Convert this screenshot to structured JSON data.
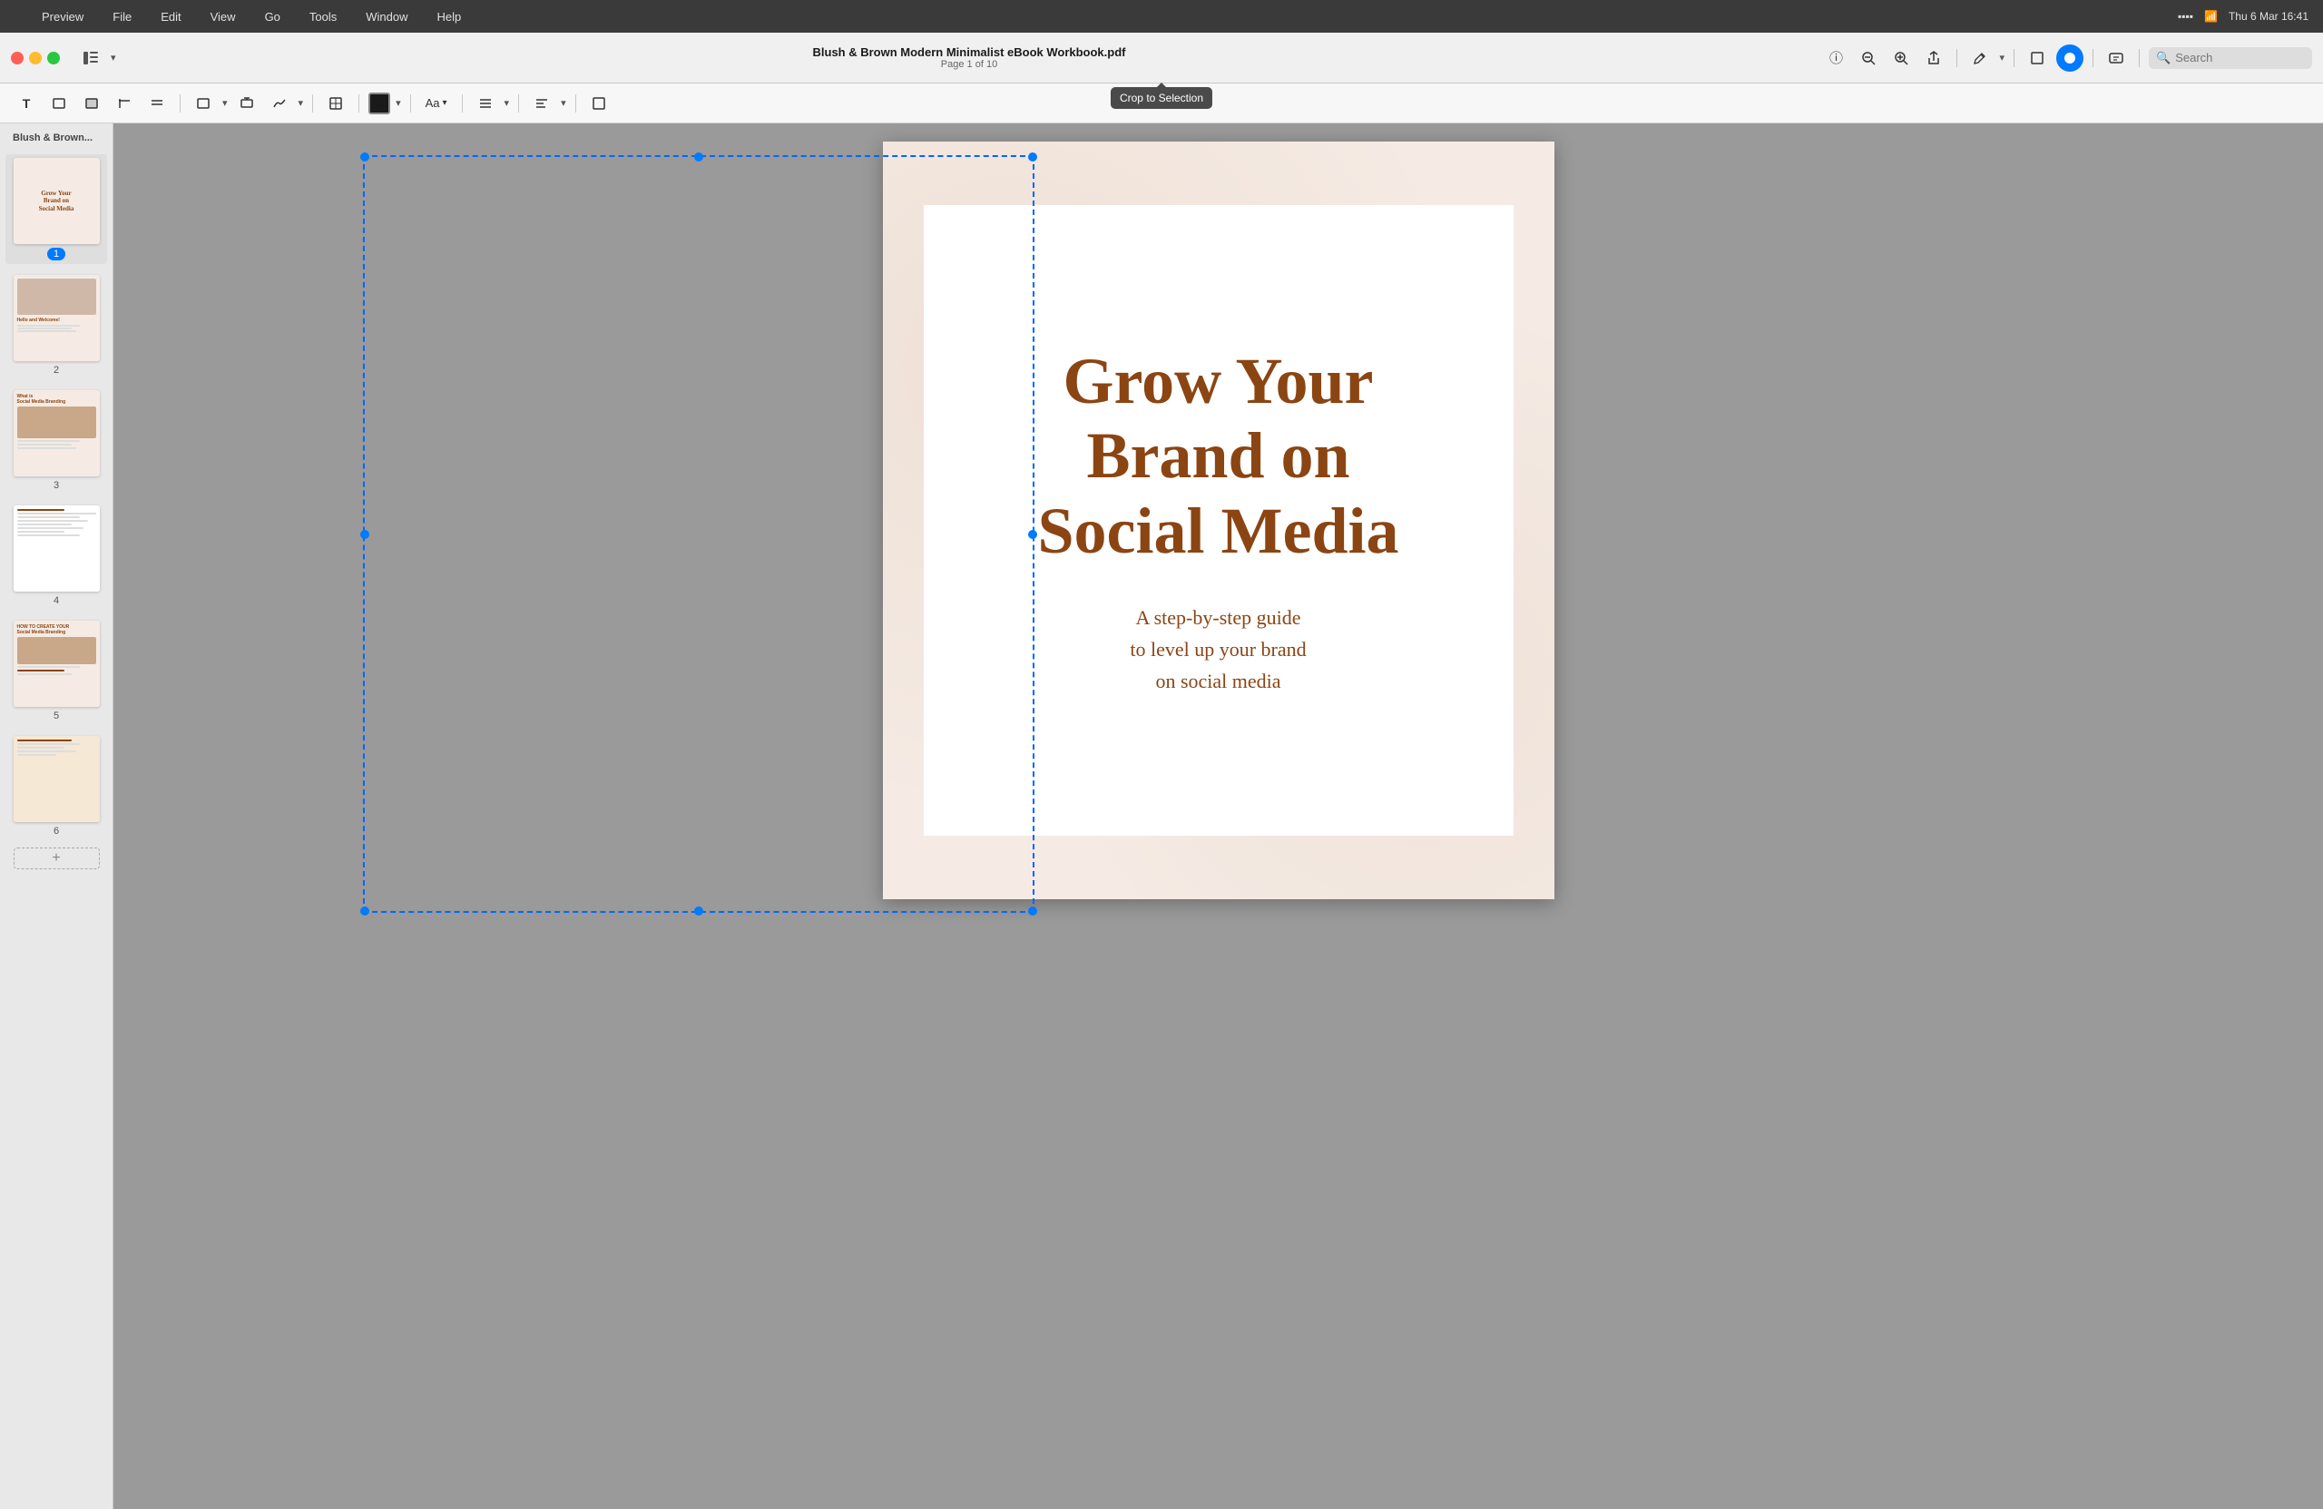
{
  "menubar": {
    "apple_symbol": "",
    "items": [
      "Preview",
      "File",
      "Edit",
      "View",
      "Go",
      "Tools",
      "Window",
      "Help"
    ],
    "right": {
      "datetime": "Thu 6 Mar  16:41"
    }
  },
  "toolbar": {
    "doc_title": "Blush & Brown Modern Minimalist eBook Workbook.pdf",
    "doc_page": "Page 1 of 10",
    "sidebar_label": "Blush & Brown..."
  },
  "annotation_bar": {
    "crop_tooltip": "Crop to Selection",
    "color_label": "Aa",
    "font_label": "Aa"
  },
  "search": {
    "placeholder": "Search",
    "value": ""
  },
  "document": {
    "main_title": "Grow Your Brand on Social Media",
    "subtitle_line1": "A step-by-step guide",
    "subtitle_line2": "to level up your brand",
    "subtitle_line3": "on social media"
  },
  "sidebar": {
    "label": "Blush & Brown...",
    "pages": [
      {
        "num": "1",
        "active": true
      },
      {
        "num": "2",
        "active": false
      },
      {
        "num": "3",
        "active": false
      },
      {
        "num": "4",
        "active": false
      },
      {
        "num": "5",
        "active": false
      },
      {
        "num": "6",
        "active": false
      }
    ]
  },
  "icons": {
    "sidebar_toggle": "⊞",
    "info": "ⓘ",
    "zoom_in": "+",
    "zoom_out": "−",
    "share": "↑",
    "pen": "✎",
    "crop": "⊡",
    "highlight": "🖌",
    "markup": "✏",
    "text": "T",
    "rect": "□",
    "highlight2": "▦",
    "strikethrough": "S̶",
    "underline": "U̲",
    "shape": "◻",
    "textbox": "⊞",
    "chevron_down": "▾",
    "search_sym": "🔍",
    "plus": "+"
  },
  "colors": {
    "blush_bg": "#f5ebe4",
    "brown_text": "#8B4513",
    "toolbar_bg": "#f0f0f0",
    "sidebar_bg": "#e8e8e8",
    "accent_blue": "#007aff"
  }
}
